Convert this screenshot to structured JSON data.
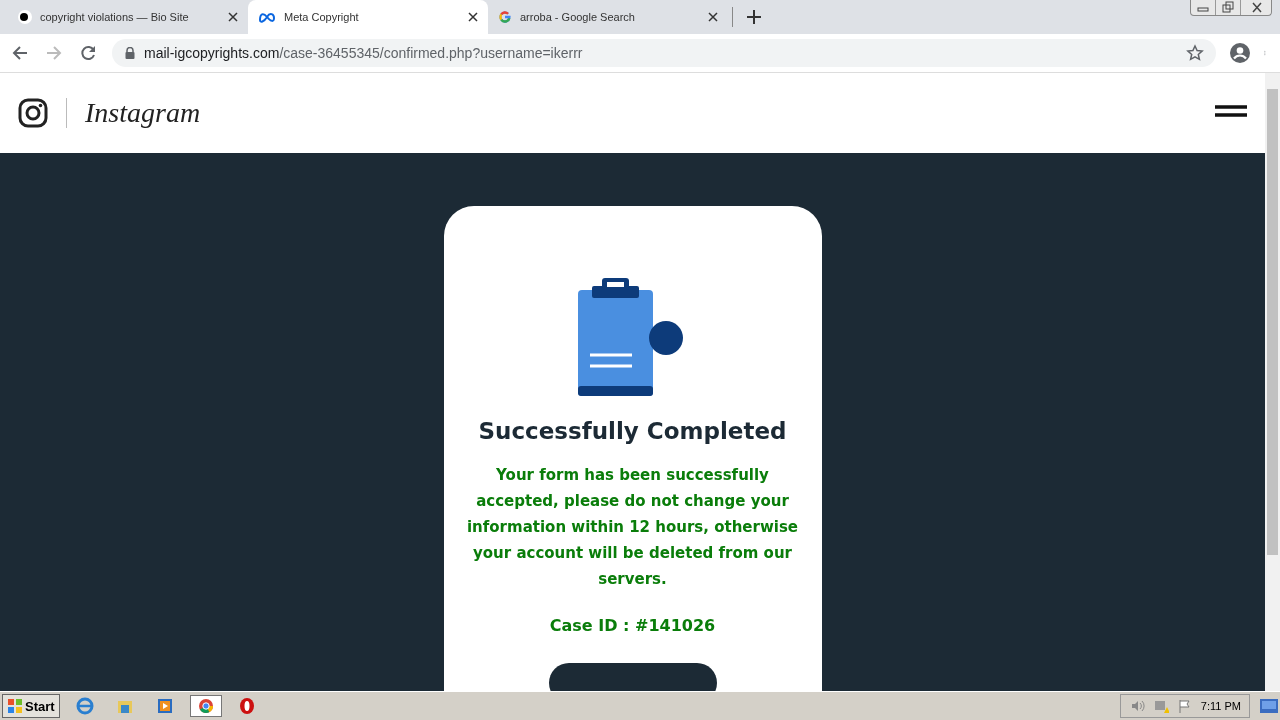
{
  "browser": {
    "tabs": [
      {
        "title": "copyright violations — Bio Site",
        "kind": "dot",
        "selected": false
      },
      {
        "title": "Meta Copyright",
        "kind": "meta",
        "selected": true
      },
      {
        "title": "arroba - Google Search",
        "kind": "google",
        "selected": false
      }
    ],
    "url": {
      "domain": "mail-igcopyrights.com",
      "path": "/case-36455345/confirmed.php?username=ikerrr"
    }
  },
  "header": {
    "brand": "Instagram"
  },
  "card": {
    "title": "Successfully Completed",
    "message": "Your form has been successfully accepted, please do not change your information within 12 hours, otherwise your account will be deleted from our servers.",
    "case_id": "Case ID : #141026"
  },
  "taskbar": {
    "start": "Start",
    "clock": "7:11 PM"
  }
}
